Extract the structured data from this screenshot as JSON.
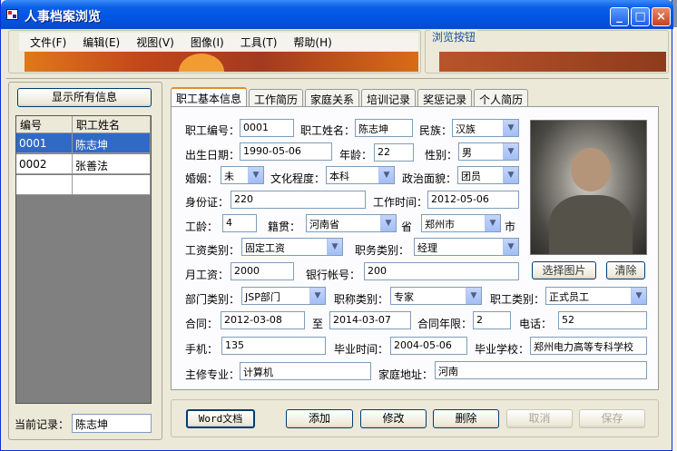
{
  "window": {
    "title": "人事档案浏览",
    "controls": {
      "minimize": "_",
      "maximize": "□",
      "close": "×"
    }
  },
  "menu": [
    "文件(F)",
    "编辑(E)",
    "视图(V)",
    "图像(I)",
    "工具(T)",
    "帮助(H)"
  ],
  "browse_group_label": "浏览按钮",
  "left": {
    "show_all_button": "显示所有信息",
    "grid": {
      "headers": [
        "编号",
        "职工姓名"
      ],
      "rows": [
        [
          "0001",
          "陈志坤"
        ],
        [
          "0002",
          "张善法"
        ]
      ],
      "selected_row": 0
    },
    "current_record_label": "当前记录：",
    "current_record_value": "陈志坤"
  },
  "tabs": [
    "职工基本信息",
    "工作简历",
    "家庭关系",
    "培训记录",
    "奖惩记录",
    "个人简历"
  ],
  "active_tab": 0,
  "form": {
    "emp_no_label": "职工编号：",
    "emp_no": "0001",
    "name_label": "职工姓名：",
    "name": "陈志坤",
    "ethnic_label": "民族：",
    "ethnic": "汉族",
    "birth_label": "出生日期：",
    "birth": "1990-05-06",
    "age_label": "年龄：",
    "age": "22",
    "gender_label": "性别：",
    "gender": "男",
    "marriage_label": "婚姻：",
    "marriage": "未",
    "education_label": "文化程度：",
    "education": "本科",
    "political_label": "政治面貌：",
    "political": "团员",
    "idcard_label": "身份证：",
    "idcard": "220",
    "worktime_label": "工作时间：",
    "worktime": "2012-05-06",
    "seniority_label": "工龄：",
    "seniority": "4",
    "native_label": "籍贯：",
    "province": "河南省",
    "province_suffix": "省",
    "city": "郑州市",
    "city_suffix": "市",
    "salary_type_label": "工资类别：",
    "salary_type": "固定工资",
    "job_type_label": "职务类别：",
    "job_type": "经理",
    "monthly_salary_label": "月工资：",
    "monthly_salary": "2000",
    "bank_label": "银行帐号：",
    "bank": "200",
    "select_photo": "选择图片",
    "clear": "清除",
    "dept_label": "部门类别：",
    "dept": "JSP部门",
    "title_label": "职称类别：",
    "title": "专家",
    "emp_type_label": "职工类别：",
    "emp_type": "正式员工",
    "contract_label": "合同：",
    "contract_start": "2012-03-08",
    "to_label": "至",
    "contract_end": "2014-03-07",
    "contract_years_label": "合同年限：",
    "contract_years": "2",
    "phone_label": "电话：",
    "phone": "52",
    "mobile_label": "手机：",
    "mobile": "135",
    "grad_time_label": "毕业时间：",
    "grad_time": "2004-05-06",
    "school_label": "毕业学校：",
    "school": "郑州电力高等专科学校",
    "major_label": "主修专业：",
    "major": "计算机",
    "address_label": "家庭地址：",
    "address": "河南"
  },
  "buttons": {
    "word": "Word文档",
    "add": "添加",
    "edit": "修改",
    "delete": "删除",
    "cancel": "取消",
    "save": "保存"
  }
}
